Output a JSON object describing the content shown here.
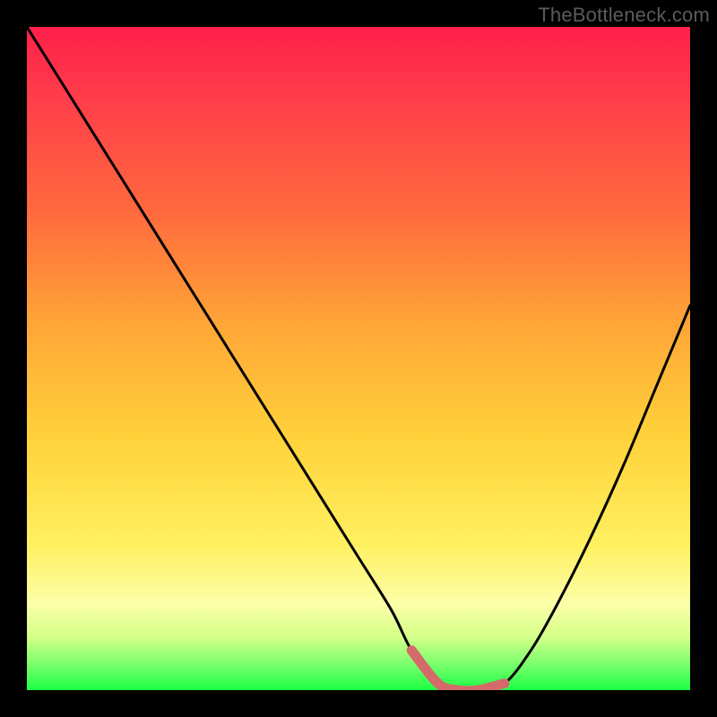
{
  "watermark": "TheBottleneck.com",
  "colors": {
    "frame": "#000000",
    "curve": "#000000",
    "optimal_segment": "#d46a6a",
    "gradient_top": "#ff1f4a",
    "gradient_bottom": "#1bff44"
  },
  "chart_data": {
    "type": "line",
    "title": "",
    "xlabel": "",
    "ylabel": "",
    "xlim": [
      0,
      100
    ],
    "ylim": [
      0,
      100
    ],
    "annotations": [],
    "series": [
      {
        "name": "bottleneck-curve",
        "x": [
          0,
          5,
          10,
          15,
          20,
          25,
          30,
          35,
          40,
          45,
          50,
          55,
          58,
          62,
          65,
          68,
          72,
          76,
          80,
          85,
          90,
          95,
          100
        ],
        "values": [
          100,
          92,
          84,
          76,
          68,
          60,
          52,
          44,
          36,
          28,
          20,
          12,
          6,
          1,
          0,
          0,
          1,
          6,
          13,
          23,
          34,
          46,
          58
        ]
      },
      {
        "name": "optimal-range",
        "x": [
          58,
          62,
          65,
          68,
          72
        ],
        "values": [
          6,
          1,
          0,
          0,
          1
        ]
      }
    ]
  }
}
